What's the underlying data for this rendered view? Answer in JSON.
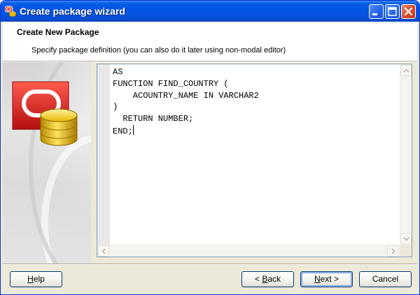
{
  "window": {
    "title": "Create package wizard"
  },
  "header": {
    "title": "Create New Package",
    "subtitle": "Specify package definition (you can also do it later using non-modal editor)"
  },
  "editor": {
    "lines": [
      "AS",
      "",
      "FUNCTION FIND_COUNTRY (",
      "    ACOUNTRY_NAME IN VARCHAR2",
      ")",
      "  RETURN NUMBER;",
      "",
      "",
      "END;"
    ]
  },
  "buttons": {
    "help_accel": "H",
    "help_rest": "elp",
    "back_prefix": "< ",
    "back_accel": "B",
    "back_rest": "ack",
    "next_accel": "N",
    "next_rest": "ext >",
    "cancel": "Cancel"
  },
  "icons": {
    "app": "oracle-database-icon",
    "minimize": "minimize-icon",
    "maximize": "maximize-icon",
    "close": "close-icon",
    "side_logo": "oracle-logo-with-database-icon"
  },
  "colors": {
    "titlebar": "#0054e3",
    "oracle_red": "#d41f1f",
    "database_gold": "#e8b800",
    "dialog_bg": "#ece9d8"
  }
}
